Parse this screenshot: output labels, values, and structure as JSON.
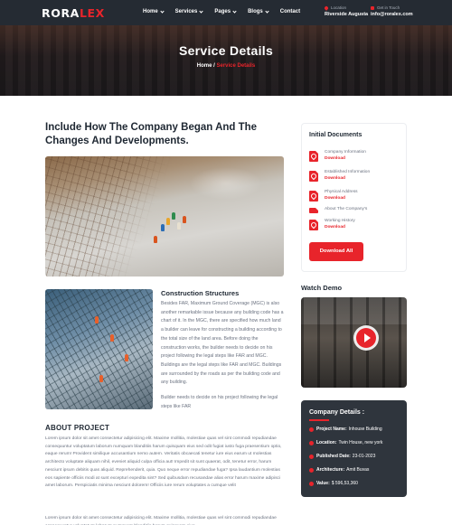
{
  "header": {
    "logo_main": "RORA",
    "logo_accent": "LEX",
    "nav": [
      {
        "label": "Home",
        "dropdown": true
      },
      {
        "label": "Services",
        "dropdown": true
      },
      {
        "label": "Pages",
        "dropdown": true
      },
      {
        "label": "Blogs",
        "dropdown": true
      },
      {
        "label": "Contact",
        "dropdown": false
      }
    ],
    "location_label": "Location",
    "location_value": "Riverside Augusta",
    "email_label": "Get in Touch",
    "email_value": "info@roralex.com"
  },
  "hero": {
    "title": "Service Details",
    "crumb_home": "Home",
    "crumb_sep": " / ",
    "crumb_current": "Service Details"
  },
  "main": {
    "title": "Include How The Company Began And The Changes And Developments.",
    "cs_title": "Construction Structures",
    "cs_body": "Besides FAR, Maximum Ground Coverage (MGC) is also another remarkable issue because any building code has a chart of it. In the MGC, there are specified how much land a builder can leave for constructing a building according to the total size of the land area. Before doing the construction works, the builder needs to decide on his project following the legal steps like FAR and MGC. Buildings are the legal steps like FAR and MGC. Buildings are surrounded by the roads as per the building code and any building.",
    "cs_body2": "Builder needs to decide on his project following the legal steps like FAR",
    "about_title": "ABOUT PROJECT",
    "about_p1": "Lorem ipsum dolor sit amet consectetur adipisicing elit. Maxime mollitia, molestiae quas vel sint commodi repudiandae consequuntur voluptatum laborum numquam blanditiis harum quisquam eius sed odit fugiat iusto fuga praesentium optio, eaque rerum! Provident similique accusantium nemo autem. Veritatis obcaecati tenetur iure eius earum ut molestias architecto voluptate aliquam nihil, eveniet aliquid culpa officia aut! Impedit sit sunt quaerat, odit, tenetur error, harum nesciunt ipsum debitis quas aliquid. Reprehenderit, quia. Quo neque error repudiandae fuga? Ipsa laudantium molestias eos sapiente officiis modi at sunt excepturi expedita sint? Sed quibusdam recusandae alias error harum maxime adipisci amet laborum. Perspiciatis minima nesciunt dolorem! Officiis iure rerum voluptates a cumque velit",
    "about_p2": "Lorem ipsum dolor sit amet consectetur adipisicing elit. Maxime mollitia, molestiae quas vel sint commodi repudiandae consequuntur voluptatum laborum numquam blanditiis harum quisquam eius"
  },
  "sidebar": {
    "docs_title": "Initial Documents",
    "docs": [
      {
        "name": "Company Information",
        "action": "Download"
      },
      {
        "name": "Established Information",
        "action": "Download"
      },
      {
        "name": "Physical Address",
        "action": "Download"
      },
      {
        "name": "About The Company's",
        "action": ""
      },
      {
        "name": "Working History",
        "action": "Download"
      }
    ],
    "download_all": "Download All",
    "watch_title": "Watch Demo",
    "company_title": "Company Details :",
    "company": [
      {
        "key": "Project Name:",
        "value": "Inhouse Building"
      },
      {
        "key": "Location:",
        "value": "Twin House, new york"
      },
      {
        "key": "Published Date:",
        "value": "23-01-2023"
      },
      {
        "key": "Architecture:",
        "value": "Amit Buvas"
      },
      {
        "key": "Value:",
        "value": "$ 596,53,360"
      }
    ]
  },
  "colors": {
    "accent": "#e8242b",
    "dark": "#252b33",
    "card_dark": "#2f353d"
  }
}
